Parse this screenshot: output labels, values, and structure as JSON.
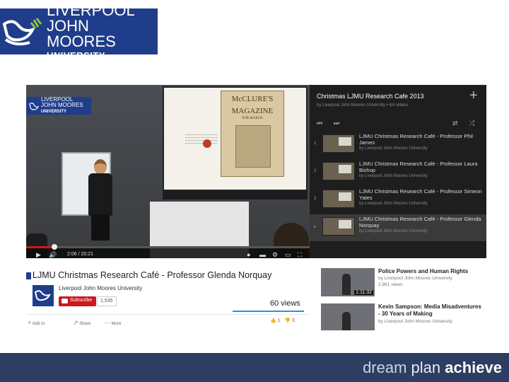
{
  "logo": {
    "line1": "LIVERPOOL",
    "line2": "JOHN MOORES",
    "line3": "UNIVERSITY"
  },
  "video": {
    "overlay_logo": {
      "line1": "LIVERPOOL",
      "line2": "JOHN MOORES",
      "line3": "UNIVERSITY"
    },
    "magazine": {
      "line1": "McCLURE'S",
      "line2": "MAGAZINE",
      "line3": "FOR MARCH"
    },
    "current_time": "2:06",
    "duration": "20:21",
    "progress_fraction": 0.1
  },
  "playlist": {
    "title": "Christmas LJMU Research Cafe 2013",
    "subtitle": "by Liverpool John Moores University • 4/4 videos",
    "items": [
      {
        "num": "1",
        "title": "LJMU Christmas Research Café - Professor Phil James",
        "channel": "by Liverpool John Moores University"
      },
      {
        "num": "2",
        "title": "LJMU Christmas Research Café - Professor Laura Bishop",
        "channel": "by Liverpool John Moores University"
      },
      {
        "num": "3",
        "title": "LJMU Christmas Research Café - Professor Simeon Yates",
        "channel": "by Liverpool John Moores University"
      },
      {
        "num": "▸",
        "title": "LJMU Christmas Research Café - Professor Glenda Norquay",
        "channel": "by Liverpool John Moores University"
      }
    ]
  },
  "info": {
    "title": "LJMU Christmas Research Café - Professor Glenda Norquay",
    "channel": "Liverpool John Moores University",
    "subscribe_label": "Subscribe",
    "subscriber_count": "1,535",
    "views": "60 views",
    "actions": {
      "add_to": "Add to",
      "share": "Share",
      "more": "More"
    },
    "likes": "1",
    "dislikes": "0"
  },
  "related": [
    {
      "title": "Police Powers and Human Rights",
      "channel": "by Liverpool John Moores University",
      "views": "2,981 views",
      "duration": "1:11:32"
    },
    {
      "title": "Kevin Sampson: Media Misadventures - 30 Years of Making",
      "channel": "by Liverpool John Moores University",
      "views": "",
      "duration": ""
    }
  ],
  "footer": {
    "word1": "dream",
    "word2": "plan",
    "word3": "achieve"
  },
  "colors": {
    "brand_blue": "#1f3d8a",
    "footer_blue": "#2d3e62",
    "youtube_red": "#cc181e"
  }
}
